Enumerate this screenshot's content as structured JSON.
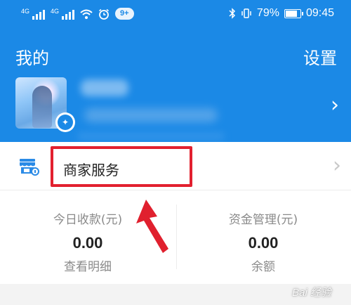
{
  "status_bar": {
    "signal_1_label": "4G",
    "signal_2_label": "4G",
    "notification_badge": "9+",
    "battery_percent": "79%",
    "time": "09:45"
  },
  "header": {
    "title": "我的",
    "settings_label": "设置"
  },
  "merchant_row": {
    "label": "商家服务"
  },
  "stats": [
    {
      "title": "今日收款(元)",
      "value": "0.00",
      "sub": "查看明细"
    },
    {
      "title": "资金管理(元)",
      "value": "0.00",
      "sub": "余额"
    }
  ],
  "watermark": "Bai 经验",
  "colors": {
    "brand_blue": "#1b89e6",
    "highlight_red": "#e2202f",
    "arrow_red": "#e0202e"
  },
  "icons": {
    "status_left": [
      "signal-icon",
      "signal-icon",
      "wifi-icon",
      "alarm-icon"
    ],
    "status_right": [
      "bluetooth-icon",
      "vibrate-icon",
      "battery-icon"
    ],
    "avatar_badge": "compass-icon",
    "merchant": "shop-icon",
    "chevrons": "chevron-right-icon"
  }
}
